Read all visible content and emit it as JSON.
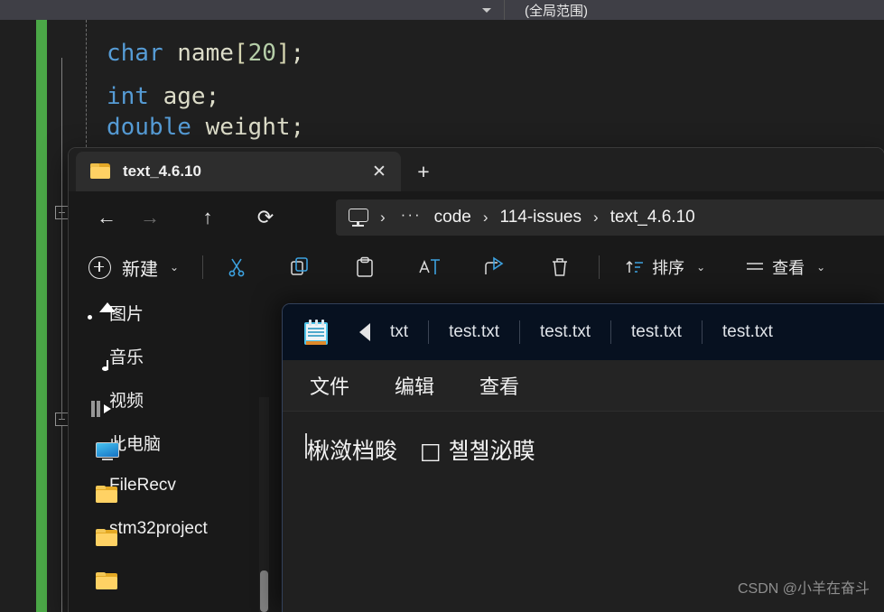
{
  "editor": {
    "navbar": {
      "scope_dropdown_value": "",
      "scope_label": "(全局范围)"
    },
    "code_lines": [
      {
        "indent": 0,
        "tokens": [
          {
            "t": "char",
            "c": "kw"
          },
          {
            "t": " ",
            "c": "pun"
          },
          {
            "t": "name",
            "c": "id"
          },
          {
            "t": "[",
            "c": "brk"
          },
          {
            "t": "20",
            "c": "num"
          },
          {
            "t": "]",
            "c": "brk"
          },
          {
            "t": ";",
            "c": "pun"
          }
        ]
      },
      {
        "indent": 0,
        "tokens": [
          {
            "t": "int",
            "c": "kw"
          },
          {
            "t": " ",
            "c": "pun"
          },
          {
            "t": "age",
            "c": "id"
          },
          {
            "t": ";",
            "c": "pun"
          }
        ]
      },
      {
        "indent": 0,
        "tokens": [
          {
            "t": "double",
            "c": "kw"
          },
          {
            "t": " ",
            "c": "pun"
          },
          {
            "t": "weight",
            "c": "id"
          },
          {
            "t": ";",
            "c": "pun"
          }
        ]
      },
      {
        "indent": 0,
        "tokens": [
          {
            "t": "}",
            "c": "brace"
          }
        ]
      }
    ]
  },
  "explorer": {
    "tab": {
      "title": "text_4.6.10",
      "close_label": "✕",
      "new_tab_label": "+"
    },
    "nav": {
      "back": "←",
      "forward": "→",
      "up": "↑",
      "refresh": "⟳"
    },
    "breadcrumb": {
      "root_icon": "monitor-icon",
      "separator": "›",
      "overflow": "···",
      "items": [
        "code",
        "114-issues",
        "text_4.6.10"
      ]
    },
    "toolbar": {
      "new_label": "新建",
      "new_caret": "⌄",
      "icons": [
        "cut-icon",
        "copy-icon",
        "paste-icon",
        "rename-icon",
        "share-icon",
        "delete-icon"
      ],
      "sort_label": "排序",
      "view_label": "查看",
      "sort_caret": "⌄",
      "view_caret": "⌄"
    },
    "sidebar": {
      "items": [
        {
          "label": "图片",
          "icon": "pictures-icon",
          "pinned": true
        },
        {
          "label": "音乐",
          "icon": "music-icon",
          "pinned": true
        },
        {
          "label": "视频",
          "icon": "videos-icon",
          "pinned": true
        },
        {
          "label": "此电脑",
          "icon": "this-pc-icon",
          "pinned": true
        },
        {
          "label": "FileRecv",
          "icon": "folder-icon",
          "pinned": false
        },
        {
          "label": "stm32project",
          "icon": "folder-icon",
          "pinned": false
        }
      ]
    }
  },
  "notepad": {
    "app_icon": "notepad-icon",
    "scroll_left_arrow": "◀",
    "tabs": [
      "txt",
      "test.txt",
      "test.txt",
      "test.txt",
      "test.txt"
    ],
    "menus": [
      "文件",
      "编辑",
      "查看"
    ],
    "content": "楸潋档畯　□ 쳴쳴泌瞙"
  },
  "watermark": {
    "text": "CSDN @小羊在奋斗"
  },
  "colors": {
    "vs_background": "#1f1f1f",
    "vs_navbar": "#3f3f46",
    "vs_change_bar_green": "#4ba747",
    "keyword_blue": "#569cd6",
    "number_green": "#b5cea8",
    "identifier": "#dcdcc8",
    "explorer_bg": "#191919",
    "explorer_tabstrip": "#202020",
    "explorer_active_tab": "#2d2d2d",
    "notepad_titlebar": "#071120",
    "notepad_menubar": "#242424",
    "accent_blue": "#3da2e0",
    "folder_yellow": "#ffd264"
  }
}
